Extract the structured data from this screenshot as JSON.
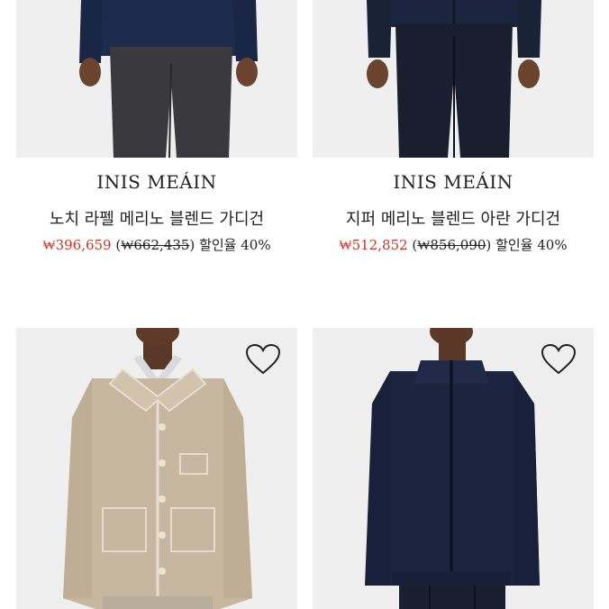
{
  "products": [
    {
      "brand": "INIS MEÁIN",
      "name": "노치 라펠 메리노 블렌드 가디건",
      "sale_price": "₩396,659",
      "original_price": "₩662,435",
      "discount": "할인율 40%"
    },
    {
      "brand": "INIS MEÁIN",
      "name": "지퍼 메리노 블렌드 아란 가디건",
      "sale_price": "₩512,852",
      "original_price": "₩856,090",
      "discount": "할인율 40%"
    },
    {
      "icon": "heart-icon"
    },
    {
      "icon": "heart-icon"
    }
  ],
  "colors": {
    "sale_price": "#c0392b",
    "image_background": "#efefef",
    "navy_knit": "#1f2a44",
    "beige_knit": "#c9b9a2"
  }
}
